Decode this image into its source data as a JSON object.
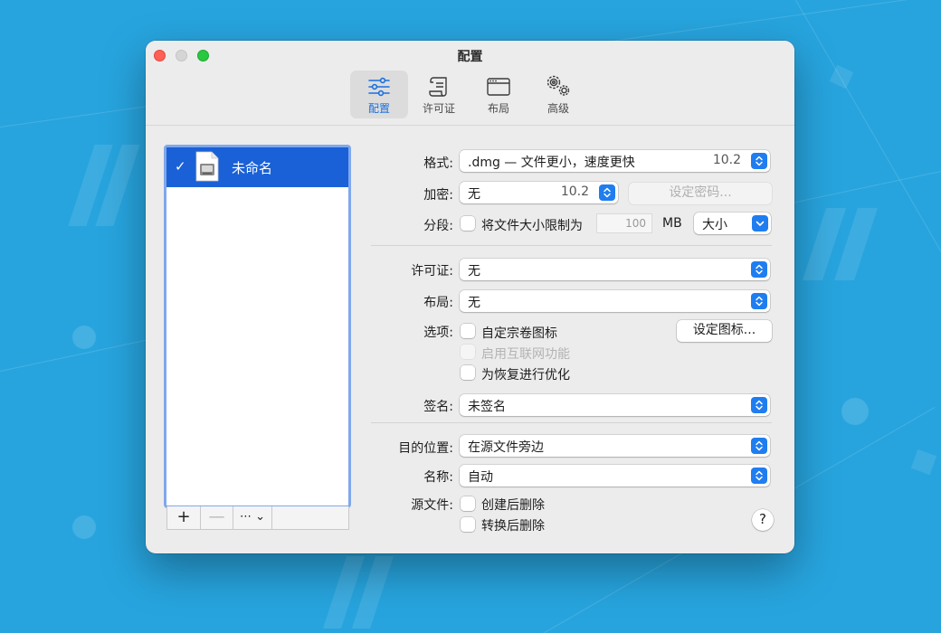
{
  "window": {
    "title": "配置"
  },
  "toolbar": {
    "items": [
      {
        "label": "配置",
        "icon": "sliders-icon",
        "active": true
      },
      {
        "label": "许可证",
        "icon": "scroll-icon",
        "active": false
      },
      {
        "label": "布局",
        "icon": "window-icon",
        "active": false
      },
      {
        "label": "高级",
        "icon": "gears-icon",
        "active": false
      }
    ]
  },
  "config_list": {
    "items": [
      {
        "label": "未命名",
        "checked": true,
        "check_mark": "✓",
        "icon": "disk-image-document-icon"
      }
    ],
    "footer": {
      "add": "+",
      "remove": "—",
      "more": "⋯ ⌄"
    }
  },
  "form": {
    "format": {
      "label": "格式:",
      "value": ".dmg — 文件更小，速度更快",
      "version": "10.2"
    },
    "encryption": {
      "label": "加密:",
      "value": "无",
      "version": "10.2",
      "password_button": "设定密码..."
    },
    "segment": {
      "label": "分段:",
      "checkbox_label": "将文件大小限制为",
      "size_value": "100",
      "unit": "MB",
      "size_option": "大小"
    },
    "license": {
      "label": "许可证:",
      "value": "无"
    },
    "layout": {
      "label": "布局:",
      "value": "无"
    },
    "options": {
      "label": "选项:",
      "custom_icon": "自定宗卷图标",
      "set_icon_button": "设定图标...",
      "internet_enable": "启用互联网功能",
      "optimize_restore": "为恢复进行优化"
    },
    "signature": {
      "label": "签名:",
      "value": "未签名"
    },
    "destination": {
      "label": "目的位置:",
      "value": "在源文件旁边"
    },
    "name": {
      "label": "名称:",
      "value": "自动"
    },
    "source": {
      "label": "源文件:",
      "delete_after_create": "创建后删除",
      "delete_after_convert": "转换后删除"
    },
    "help_button": "?"
  },
  "colors": {
    "accent": "#1f7df0",
    "selection": "#1a61d7",
    "background": "#27a4de"
  }
}
